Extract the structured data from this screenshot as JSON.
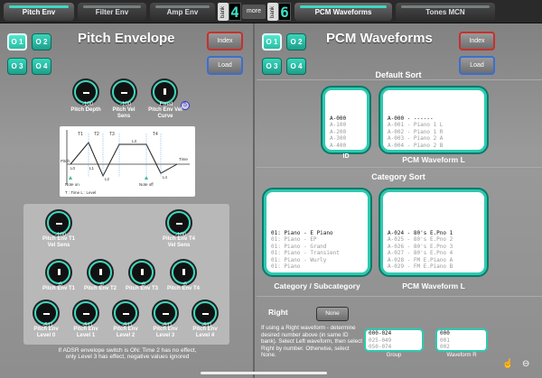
{
  "tabs": {
    "pitch_env": "Pitch Env",
    "filter_env": "Filter Env",
    "amp_env": "Amp Env",
    "pcm_waveforms": "PCM Waveforms",
    "tones_mcn": "Tones MCN"
  },
  "bank_left": {
    "label": "bank",
    "digit": "4"
  },
  "more": "more",
  "bank_right": {
    "label": "bank",
    "digit": "6"
  },
  "left": {
    "ops": [
      "O 1",
      "O 2",
      "O 3",
      "O 4"
    ],
    "title": "Pitch Envelope",
    "index": "Index",
    "load": "Load",
    "knobs_top": [
      {
        "value": "-100",
        "label": "Pitch Depth"
      },
      {
        "value": "-100",
        "label": "Pitch Vel\nSens"
      },
      {
        "value": "Fixed",
        "label": "Pitch Env Vel\nCurve"
      }
    ],
    "curve_badge": "5",
    "diagram": {
      "t1": "T1",
      "t2": "T2",
      "t3": "T3",
      "t4": "T4",
      "l0": "L0",
      "l1": "L1",
      "l2": "L2",
      "l3": "L3",
      "l4": "L4",
      "pitch": "Pitch",
      "time": "Time",
      "note_on": "Note on",
      "note_off": "Note off",
      "legend": "T : Time     L : Level"
    },
    "knobs_box": [
      {
        "value": "-100",
        "label": "Pitch Env T1\nVel Sens"
      },
      {
        "value": "-100",
        "label": "Pitch Env T4\nVel Sens"
      },
      {
        "value": "0",
        "label": "Pitch Env T1"
      },
      {
        "value": "0",
        "label": "Pitch Env T2"
      },
      {
        "value": "0",
        "label": "Pitch Env T3"
      },
      {
        "value": "0",
        "label": "Pitch Env T4"
      },
      {
        "value": "-511",
        "label": "Pitch Env\nLevel 0"
      },
      {
        "value": "-511",
        "label": "Pitch Env\nLevel 1"
      },
      {
        "value": "-511",
        "label": "Pitch Env\nLevel 2"
      },
      {
        "value": "-511",
        "label": "Pitch Env\nLevel 3"
      },
      {
        "value": "-511",
        "label": "Pitch Env\nLevel 4"
      }
    ],
    "note": "If ADSR envelope switch is ON: Time 2 has no effect,\nonly Level 3 has effect, negative values ignored"
  },
  "right": {
    "ops": [
      "O 1",
      "O 2",
      "O 3",
      "O 4"
    ],
    "title": "PCM Waveforms",
    "index": "Index",
    "load": "Load",
    "default_sort": "Default Sort",
    "id_list": [
      "A-000",
      "A-100",
      "A-200",
      "A-300",
      "A-400"
    ],
    "id_caption": "ID",
    "pcm_list_1": [
      "A-000 - ------",
      "A-001 - Piano 1 L",
      "A-002 - Piano 1 R",
      "A-003 - Piano 2 A",
      "A-004 - Piano 2 B"
    ],
    "pcm_caption_1": "PCM Waveform L",
    "category_sort": "Category Sort",
    "cat_list": [
      "01: Piano - E Piano",
      "01: Piano - EP",
      "01: Piano - Grand",
      "01: Piano - Transient",
      "01: Piano - Wurly",
      "01: Piano"
    ],
    "cat_caption": "Category / Subcategory",
    "pcm_list_2": [
      "A-024 - 80's E.Pno 1",
      "A-025 - 80's E.Pno 2",
      "A-026 - 80's E.Pno 3",
      "A-027 - 80's E.Pno 4",
      "A-028 - FM E.Piano A",
      "A-029 - FM E.Piano B"
    ],
    "pcm_caption_2": "PCM Waveform L",
    "right_title": "Right",
    "none_btn": "None",
    "help": "If using a Right waveform - determine desired number above (in same ID bank). Select Left waveform, then select Right by number. Otherwise, select None.",
    "group_list": [
      "000-024",
      "025-049",
      "050-074"
    ],
    "group_caption": "Group",
    "wr_list": [
      "000",
      "001",
      "002"
    ],
    "wr_caption": "Waveform R"
  }
}
